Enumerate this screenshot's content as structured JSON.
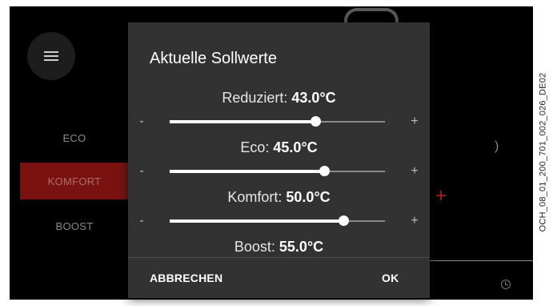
{
  "background": {
    "menu_icon": "hamburger-menu-icon",
    "modes": [
      {
        "label": "ECO",
        "active": false
      },
      {
        "label": "KOMFORT",
        "active": true
      },
      {
        "label": "BOOST",
        "active": false
      }
    ],
    "plus_glyph": "+",
    "paren_glyph": ")",
    "clock_icon": "clock-icon"
  },
  "dialog": {
    "title": "Aktuelle Sollwerte",
    "minus_glyph": "-",
    "plus_glyph": "+",
    "setpoints": [
      {
        "label": "Reduziert:",
        "value": "43.0°C",
        "slider_fraction": 0.68
      },
      {
        "label": "Eco:",
        "value": "45.0°C",
        "slider_fraction": 0.72
      },
      {
        "label": "Komfort:",
        "value": "50.0°C",
        "slider_fraction": 0.81
      },
      {
        "label": "Boost:",
        "value": "55.0°C"
      }
    ],
    "cancel_label": "ABBRECHEN",
    "ok_label": "OK"
  },
  "watermark": "OCH_08_01_200_701_002_026_DE02",
  "colors": {
    "screen_background": "#000000",
    "dialog_background": "#323232",
    "active_mode": "#7a1212",
    "accent_red": "#b31c1c"
  }
}
